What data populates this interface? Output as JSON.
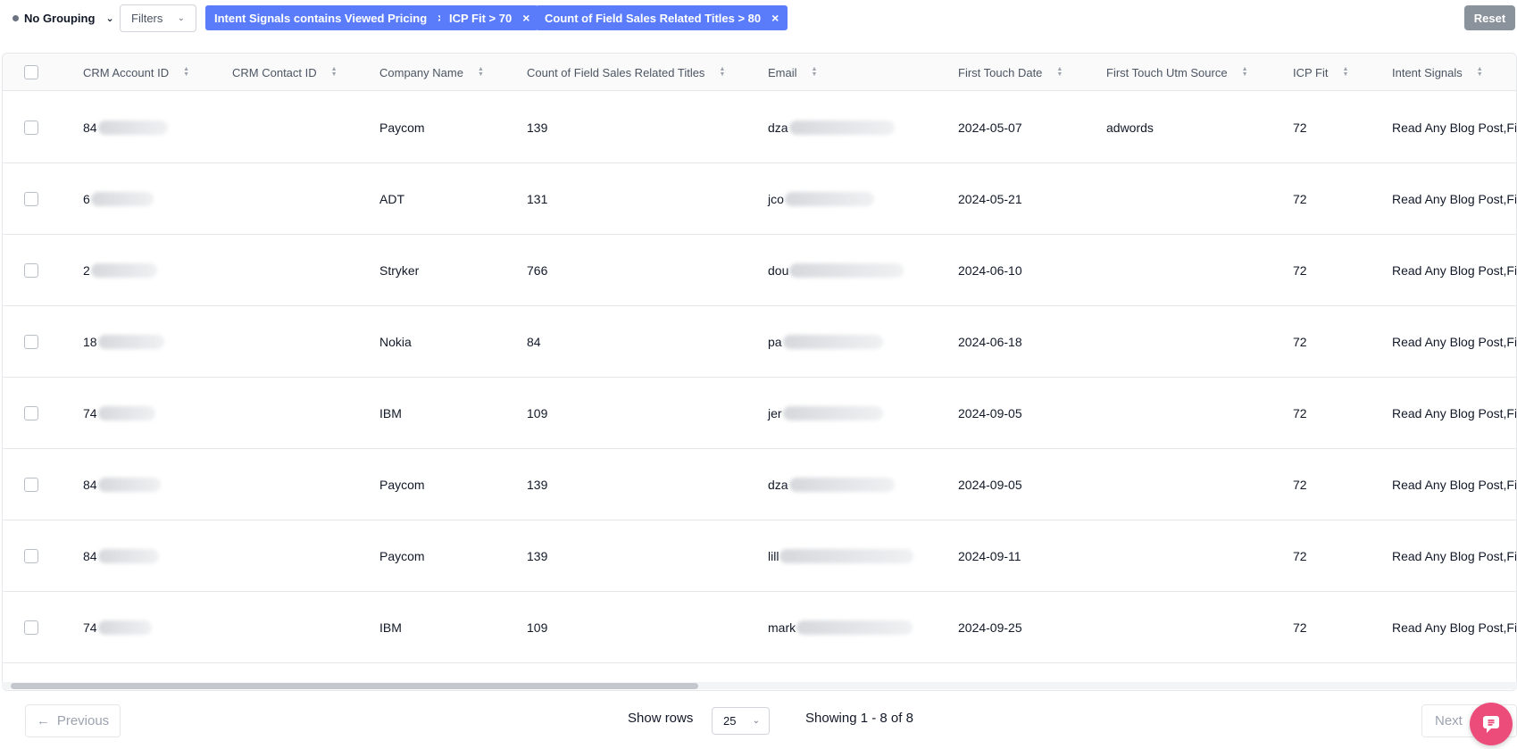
{
  "toolbar": {
    "grouping_label": "No Grouping",
    "filters_label": "Filters",
    "chips": [
      {
        "label": "Intent Signals contains Viewed Pricing"
      },
      {
        "label": "ICP Fit > 70"
      },
      {
        "label": "Count of Field Sales Related Titles > 80"
      }
    ],
    "chip_close": "×",
    "reset_label": "Reset"
  },
  "table": {
    "columns": [
      "CRM Account ID",
      "CRM Contact ID",
      "Company Name",
      "Count of Field Sales Related Titles",
      "Email",
      "First Touch Date",
      "First Touch Utm Source",
      "ICP Fit",
      "Intent Signals"
    ],
    "rows": [
      {
        "account_id": "84",
        "contact_id": "",
        "company": "Paycom",
        "count": "139",
        "email": "dza",
        "date": "2024-05-07",
        "utm": "adwords",
        "icp": "72",
        "intent": "Read Any Blog Post,Fie"
      },
      {
        "account_id": "6",
        "contact_id": "",
        "company": "ADT",
        "count": "131",
        "email": "jco",
        "date": "2024-05-21",
        "utm": "",
        "icp": "72",
        "intent": "Read Any Blog Post,Fie"
      },
      {
        "account_id": "2",
        "contact_id": "",
        "company": "Stryker",
        "count": "766",
        "email": "dou",
        "date": "2024-06-10",
        "utm": "",
        "icp": "72",
        "intent": "Read Any Blog Post,Fie"
      },
      {
        "account_id": "18",
        "contact_id": "",
        "company": "Nokia",
        "count": "84",
        "email": "pa",
        "date": "2024-06-18",
        "utm": "",
        "icp": "72",
        "intent": "Read Any Blog Post,Fie"
      },
      {
        "account_id": "74",
        "contact_id": "",
        "company": "IBM",
        "count": "109",
        "email": "jer",
        "date": "2024-09-05",
        "utm": "",
        "icp": "72",
        "intent": "Read Any Blog Post,Fie"
      },
      {
        "account_id": "84",
        "contact_id": "",
        "company": "Paycom",
        "count": "139",
        "email": "dza",
        "date": "2024-09-05",
        "utm": "",
        "icp": "72",
        "intent": "Read Any Blog Post,Fie"
      },
      {
        "account_id": "84",
        "contact_id": "",
        "company": "Paycom",
        "count": "139",
        "email": "lill",
        "date": "2024-09-11",
        "utm": "",
        "icp": "72",
        "intent": "Read Any Blog Post,Fie"
      },
      {
        "account_id": "74",
        "contact_id": "",
        "company": "IBM",
        "count": "109",
        "email": "mark",
        "date": "2024-09-25",
        "utm": "",
        "icp": "72",
        "intent": "Read Any Blog Post,Fie"
      }
    ]
  },
  "pagination": {
    "previous_label": "Previous",
    "show_rows_label": "Show rows",
    "rows_per_page": "25",
    "showing_text": "Showing 1 - 8 of 8",
    "next_label": "Next"
  },
  "colors": {
    "chip_bg": "#5b7cfa",
    "reset_bg": "#8a929c",
    "chat_bubble": "#ec4c7a"
  },
  "icons": {
    "grouping_dot": "dot-icon",
    "sort": "sort-icon",
    "previous": "arrow-left-icon",
    "chat": "chat-icon"
  }
}
